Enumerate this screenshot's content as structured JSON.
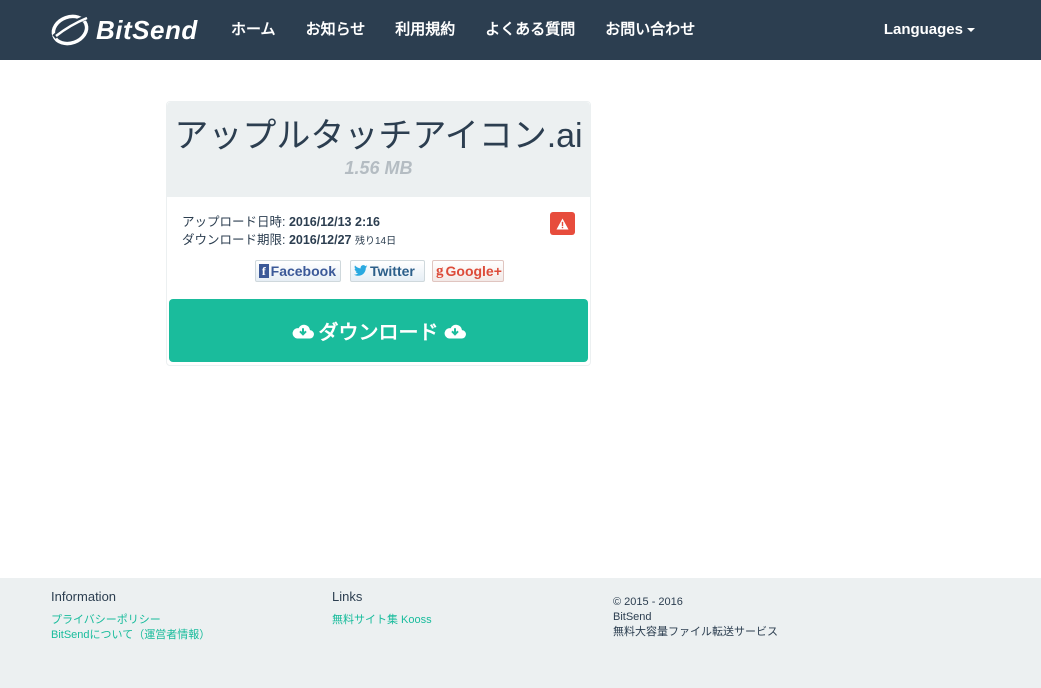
{
  "nav": {
    "brand": "BitSend",
    "items": [
      "ホーム",
      "お知らせ",
      "利用規約",
      "よくある質問",
      "お問い合わせ"
    ],
    "languages": "Languages"
  },
  "file": {
    "name": "アップルタッチアイコン.ai",
    "size": "1.56 MB",
    "upload_label": "アップロード日時: ",
    "upload_date": "2016/12/13 2:16",
    "expire_label": "ダウンロード期限: ",
    "expire_date": "2016/12/27",
    "remaining": "残り14日"
  },
  "share": {
    "facebook": "Facebook",
    "twitter": "Twitter",
    "google": "Google+"
  },
  "download_label": "ダウンロード",
  "footer": {
    "info_title": "Information",
    "privacy": "プライバシーポリシー",
    "about": "BitSendについて（運営者情報）",
    "links_title": "Links",
    "kooss": "無料サイト集 Kooss",
    "copyright": "© 2015 - 2016",
    "brand": "BitSend",
    "tagline": "無料大容量ファイル転送サービス"
  },
  "colors": {
    "navbar": "#2c3e50",
    "accent": "#1abc9c",
    "danger": "#e74c3c",
    "footer_bg": "#ecf0f1"
  }
}
